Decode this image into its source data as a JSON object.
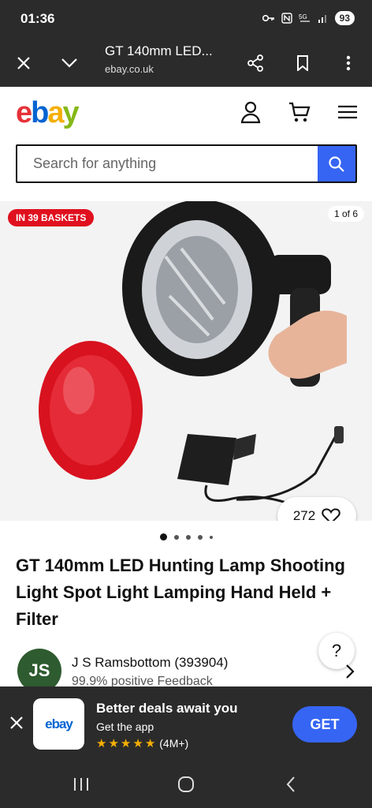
{
  "status_bar": {
    "time": "01:36",
    "battery": "93"
  },
  "browser": {
    "title": "GT 140mm LED...",
    "url": "ebay.co.uk"
  },
  "ebay": {
    "logo": [
      "e",
      "b",
      "a",
      "y"
    ],
    "search_placeholder": "Search for anything"
  },
  "gallery": {
    "badge": "IN 39 BASKETS",
    "counter": "1 of 6",
    "watch_count": "272"
  },
  "product": {
    "title": "GT 140mm LED Hunting Lamp Shooting Light Spot Light Lamping Hand Held + Filter"
  },
  "help": {
    "label": "?"
  },
  "seller": {
    "initials": "JS",
    "name": "J S Ramsbottom (393904)",
    "feedback": "99.9% positive Feedback"
  },
  "app_banner": {
    "logo_text": "ebay",
    "title": "Better deals await you",
    "subtitle": "Get the app",
    "rating": "(4M+)",
    "cta": "GET"
  },
  "colors": {
    "accent": "#3665f3",
    "badge_red": "#e0101e",
    "dark_bar": "#2b2b2b"
  }
}
